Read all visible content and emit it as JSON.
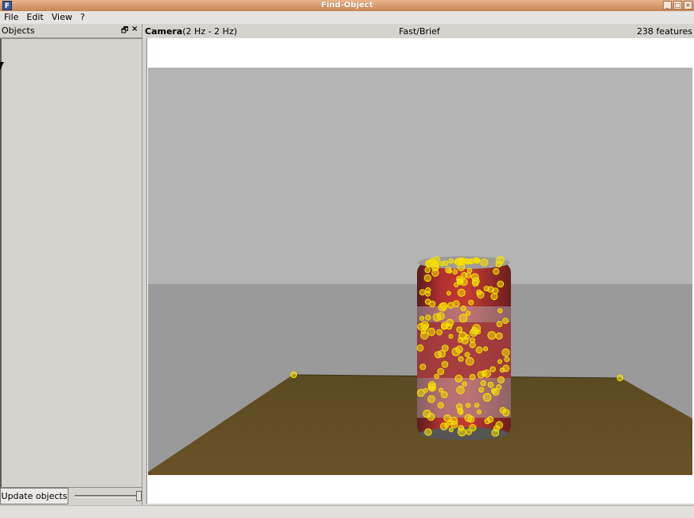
{
  "window": {
    "title": "Find-Object",
    "controls": [
      "_",
      "□",
      "×"
    ]
  },
  "menu": [
    "File",
    "Edit",
    "View",
    "?"
  ],
  "objects_panel": {
    "title": "Objects",
    "float_glyph": "🗗",
    "close_glyph": "×",
    "update_button": "Update objects"
  },
  "view": {
    "camera_label": "Camera",
    "camera_rate": "(2 Hz - 2 Hz)",
    "detector": "Fast/Brief",
    "features": "238 features"
  },
  "colors": {
    "feature_marker": "#f5e000",
    "can_red": "#9b2222",
    "table_wood": "#5e4a1e",
    "wall": "#b4b4b4"
  }
}
